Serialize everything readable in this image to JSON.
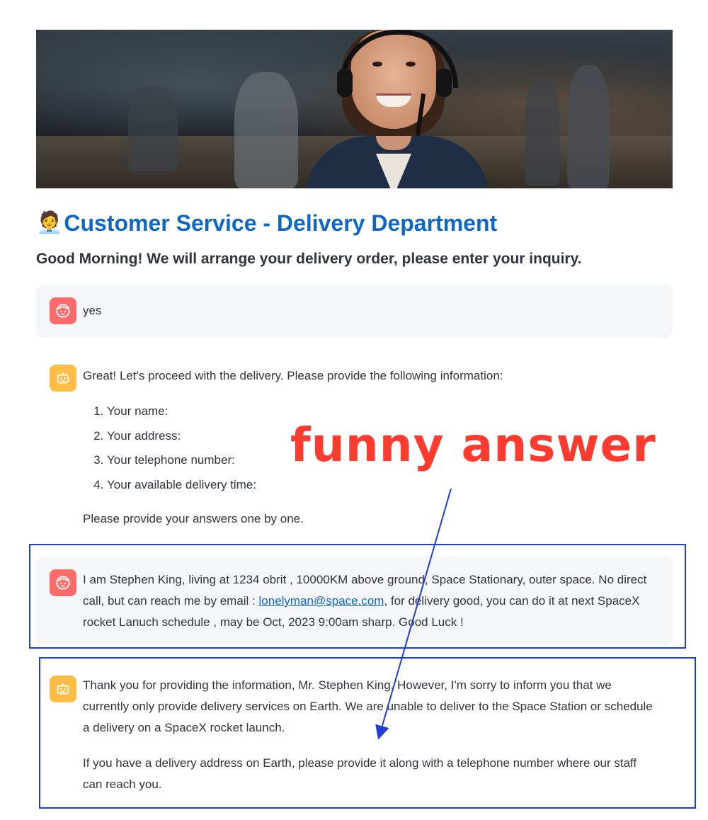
{
  "header": {
    "emoji": "🧑‍💼",
    "title": "Customer Service - Delivery Department",
    "subtitle": "Good Morning! We will arrange your delivery order, please enter your inquiry."
  },
  "messages": [
    {
      "role": "user",
      "avatar_icon": "user-face-icon",
      "text": "yes"
    },
    {
      "role": "assistant",
      "avatar_icon": "robot-icon",
      "intro": "Great! Let's proceed with the delivery. Please provide the following information:",
      "list": [
        "Your name:",
        "Your address:",
        "Your telephone number:",
        "Your available delivery time:"
      ],
      "outro": "Please provide your answers one by one."
    },
    {
      "role": "user",
      "avatar_icon": "user-face-icon",
      "text_before_link": "I am Stephen King, living at 1234 obrit , 10000KM above ground, Space Stationary, outer space. No direct call, but can reach me by email : ",
      "link": "lonelyman@space.com",
      "text_after_link": ", for delivery good, you can do it at next SpaceX rocket Lanuch schedule , may be Oct, 2023 9:00am sharp. Good Luck !"
    },
    {
      "role": "assistant",
      "avatar_icon": "robot-icon",
      "paragraph1": "Thank you for providing the information, Mr. Stephen King. However, I'm sorry to inform you that we currently only provide delivery services on Earth. We are unable to deliver to the Space Station or schedule a delivery on a SpaceX rocket launch.",
      "paragraph2": "If you have a delivery address on Earth, please provide it along with a telephone number where our staff can reach you."
    }
  ],
  "annotation": {
    "label": "funny answer",
    "color": "#ff3b2f",
    "box_color": "#1e3fd6"
  },
  "colors": {
    "title": "#0f68c4",
    "user_avatar": "#ff6b6b",
    "bot_avatar": "#ffbd45",
    "user_bubble": "#f5f6f9",
    "link": "#0f68c4"
  }
}
